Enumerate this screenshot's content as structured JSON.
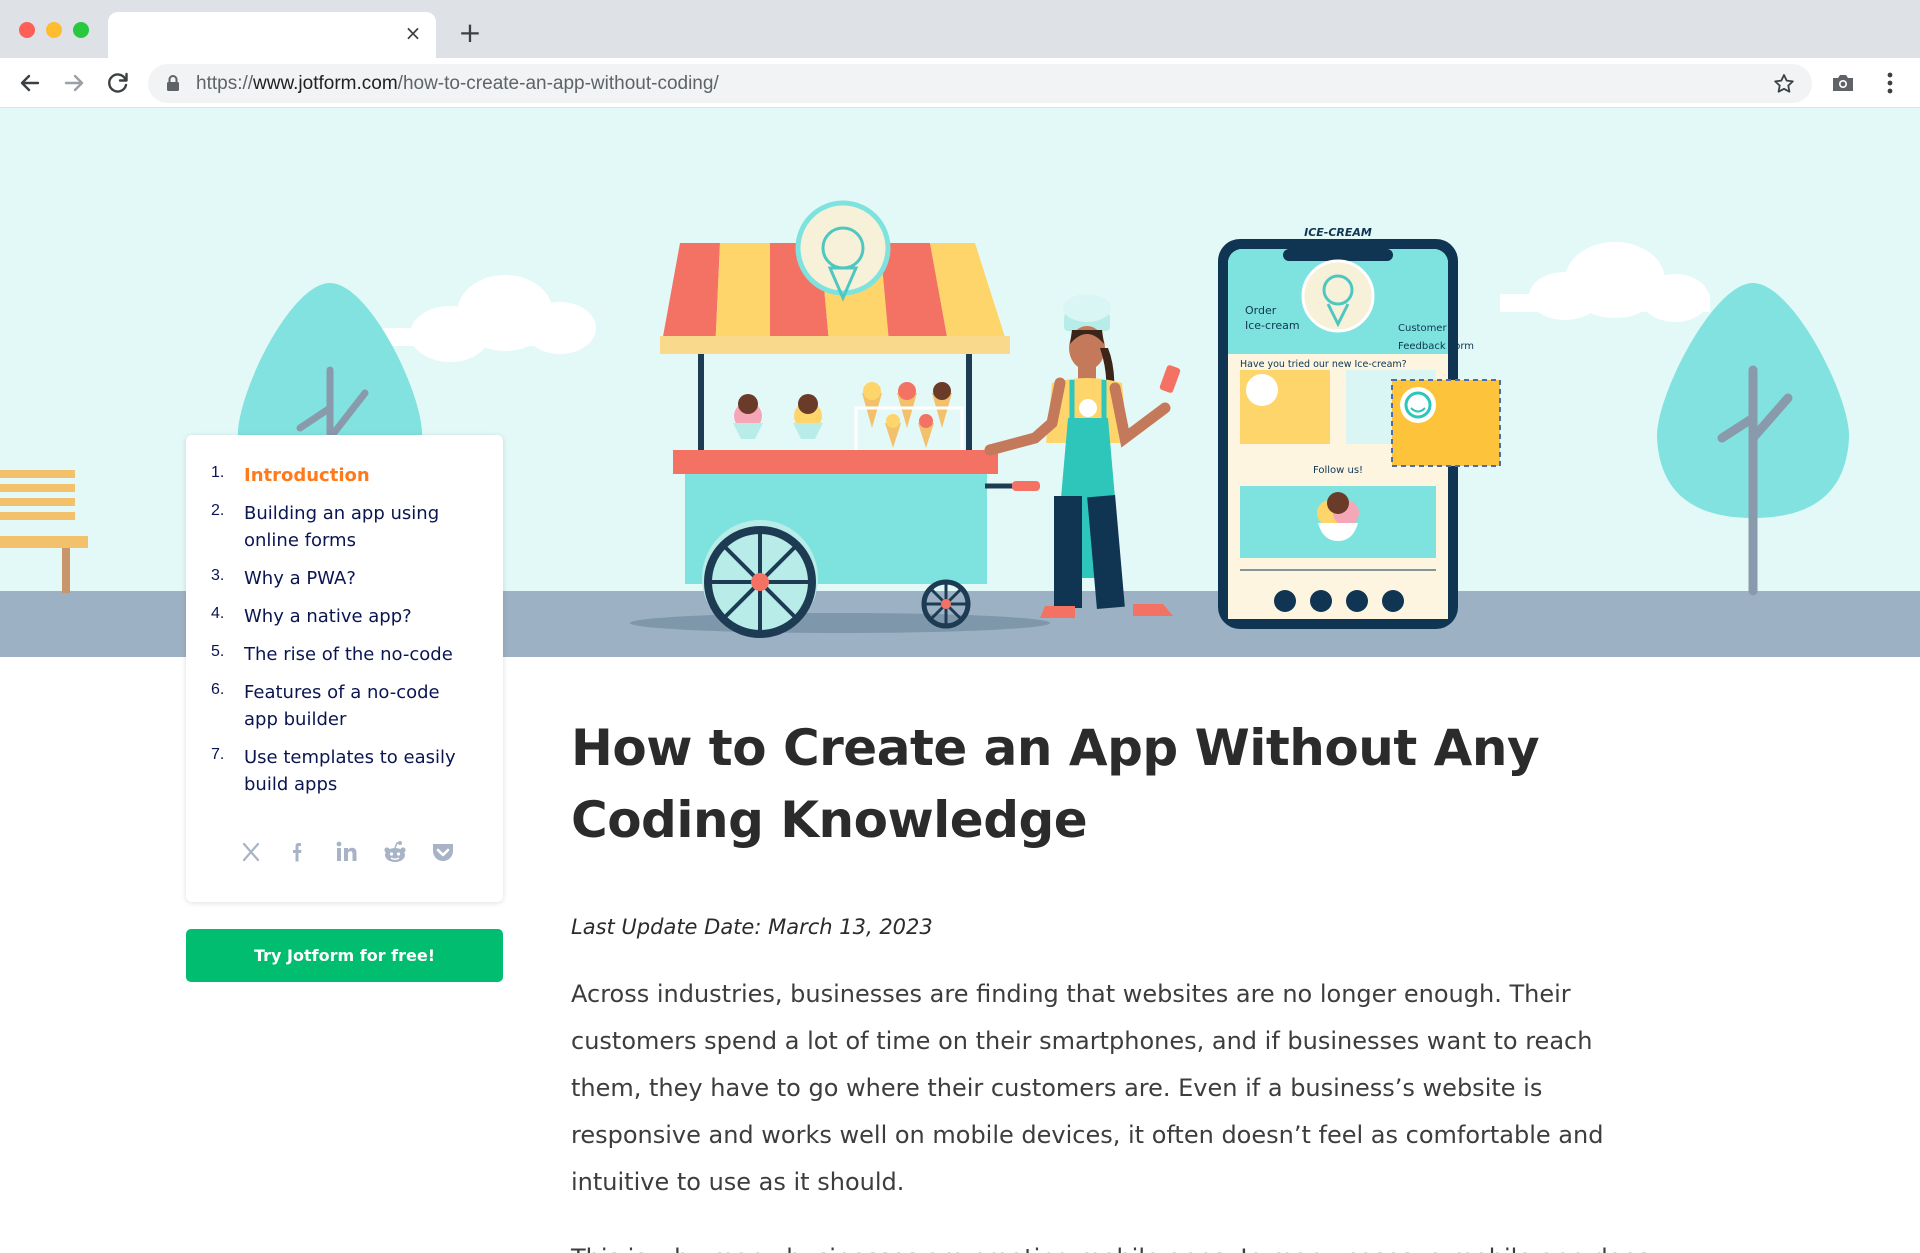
{
  "browser": {
    "url_scheme": "https://",
    "url_host": "www.jotform.com",
    "url_path": "/how-to-create-an-app-without-coding/",
    "tab_close": "×",
    "new_tab": "+"
  },
  "hero": {
    "phone_brand": "ICE-CREAM",
    "phone_card_order": [
      "Order",
      "Ice-cream"
    ],
    "phone_card_feedback": [
      "Customer",
      "Feedback Form"
    ],
    "phone_question": "Have you tried our new Ice-cream?",
    "phone_follow": "Follow us!",
    "colors": {
      "sky": "#e3f9f7",
      "ground": "#9cb2c4",
      "teal": "#7ee3df",
      "awning_red": "#f47264",
      "awning_yellow": "#fdd56b"
    }
  },
  "toc": {
    "items": [
      {
        "num": "1.",
        "label": "Introduction"
      },
      {
        "num": "2.",
        "label": "Building an app using online forms"
      },
      {
        "num": "3.",
        "label": "Why a PWA?"
      },
      {
        "num": "4.",
        "label": "Why a native app?"
      },
      {
        "num": "5.",
        "label": "The rise of the no-code"
      },
      {
        "num": "6.",
        "label": "Features of a no-code app builder"
      },
      {
        "num": "7.",
        "label": "Use templates to easily build apps"
      }
    ],
    "share_icons": [
      "x-icon",
      "facebook-icon",
      "linkedin-icon",
      "reddit-icon",
      "pocket-icon"
    ],
    "active_color": "#ff7a1a"
  },
  "cta": {
    "label": "Try Jotform for free!",
    "color": "#01bd6f"
  },
  "article": {
    "title": "How to Create an App Without Any Coding Knowledge",
    "updated": "Last Update Date: March 13, 2023",
    "paragraph1": "Across industries, businesses are finding that websites are no longer enough. Their customers spend a lot of time on their smartphones, and if businesses want to reach them, they have to go where their customers are. Even if a business’s website is responsive and works well on mobile devices, it often doesn’t feel as comfortable and intuitive to use as it should.",
    "paragraph2": "This is why many businesses are creating mobile apps. In many cases, a mobile app does"
  }
}
